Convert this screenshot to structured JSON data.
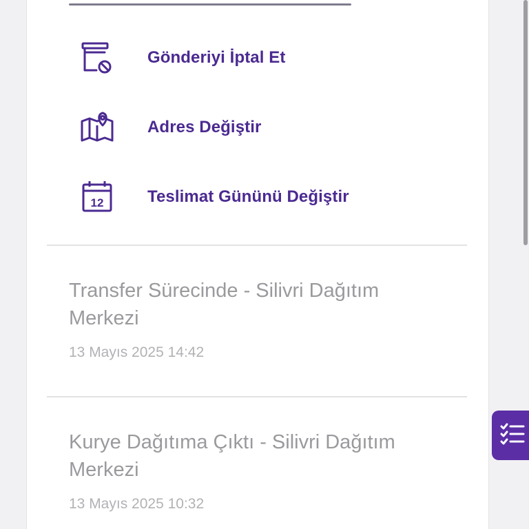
{
  "actions": [
    {
      "label": "Gönderiyi İptal Et",
      "icon": "cancel-shipment-icon"
    },
    {
      "label": "Adres Değiştir",
      "icon": "map-pin-icon"
    },
    {
      "label": "Teslimat Gününü Değiştir",
      "icon": "calendar-icon",
      "calendar_day": "12"
    }
  ],
  "timeline": [
    {
      "title_line1": "Transfer Sürecinde - Silivri Dağıtım",
      "title_line2": "Merkezi",
      "time": "13 Mayıs 2025 14:42"
    },
    {
      "title_line1": "Kurye Dağıtıma Çıktı - Silivri Dağıtım",
      "title_line2": "Merkezi",
      "time": "13 Mayıs 2025 10:32"
    }
  ],
  "fab": {
    "icon": "checklist-icon"
  },
  "colors": {
    "accent": "#5b2ea6",
    "action_text": "#4b2a91",
    "muted_text": "#9a9a9e"
  }
}
